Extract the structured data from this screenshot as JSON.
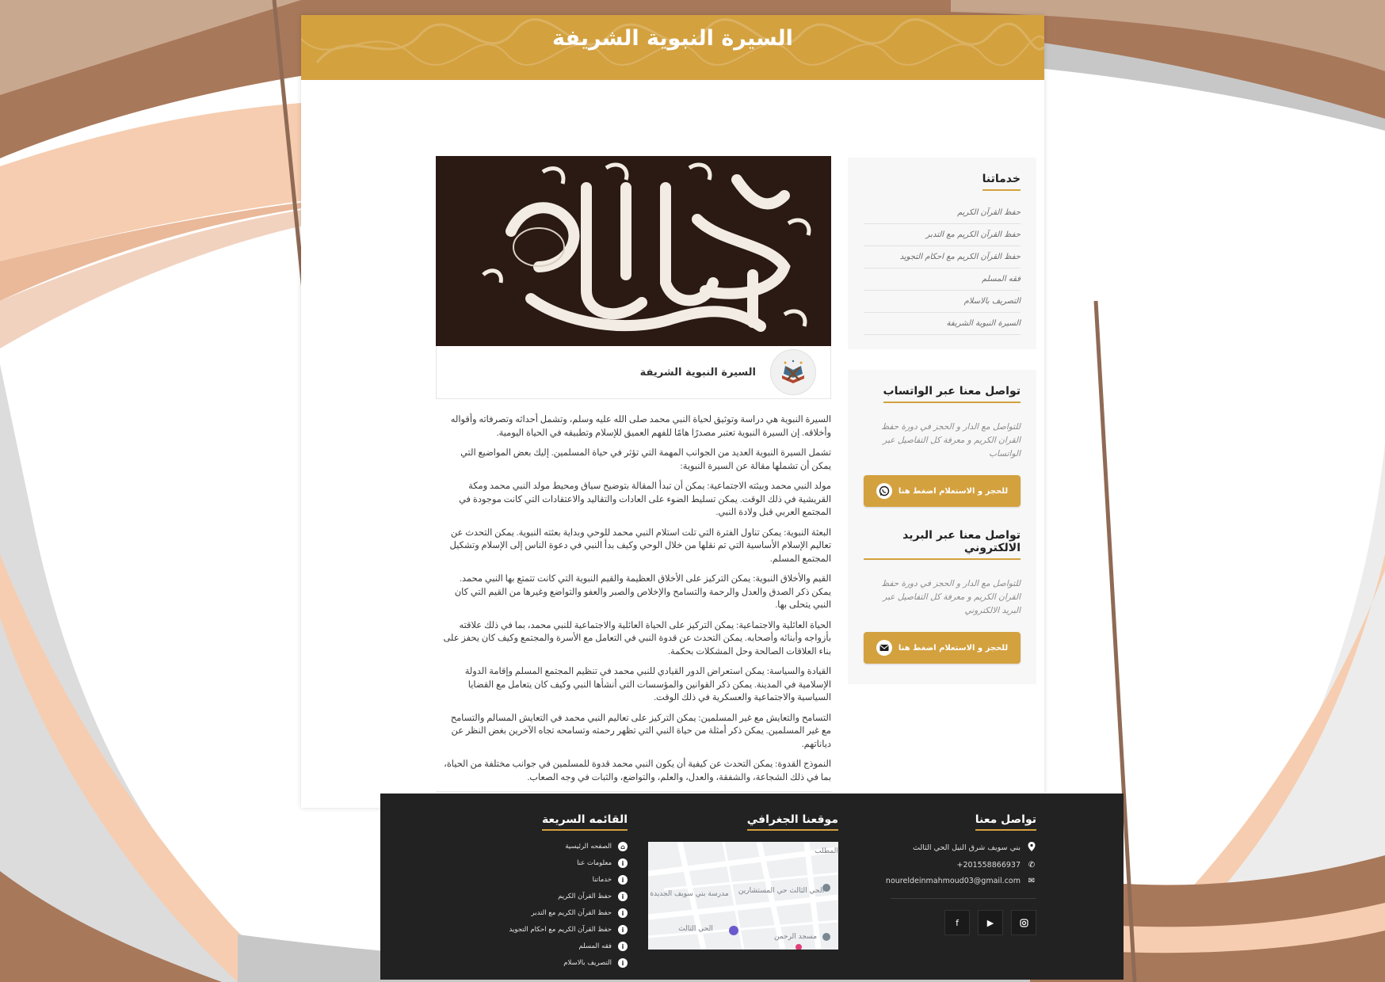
{
  "page": {
    "title": "السيرة النبوية الشريفة"
  },
  "sidebar": {
    "services": {
      "heading": "خدماتنا",
      "items": [
        "حفظ القرآن الكريم",
        "حفظ القرآن الكريم مع التدبر",
        "حفظ القرآن الكريم مع احكام التجويد",
        "فقه المسلم",
        "التصريف بالاسلام",
        "السيرة النبوية الشريفة"
      ]
    },
    "whatsapp": {
      "heading": "تواصل معنا عبر الواتساب",
      "note": "للتواصل مع الدار و الحجز في دورة حفظ القران الكريم و معرفة كل التفاصيل عبر الواتساب",
      "button": "للحجز و الاستعلام اضغط هنا"
    },
    "email": {
      "heading": "تواصل معنا عبر البريد الالكتروني",
      "note": "للتواصل مع الدار و الحجز في دورة حفظ القران الكريم و معرفة كل التفاصيل عبر البريد الالكتروني",
      "button": "للحجز و الاستعلام اضغط هنا"
    }
  },
  "article": {
    "card_title": "السيرة النبوية الشريفة",
    "paragraphs": [
      "السيرة النبوية هي دراسة وتوثيق لحياة النبي محمد صلى الله عليه وسلم، وتشمل أحداثه وتصرفاته وأقواله وأخلاقه. إن السيرة النبوية تعتبر مصدرًا هامًا للفهم العميق للإسلام وتطبيقه في الحياة اليومية.",
      "تشمل السيرة النبوية العديد من الجوانب المهمة التي تؤثر في حياة المسلمين. إليك بعض المواضيع التي يمكن أن تشملها مقالة عن السيرة النبوية:",
      "مولد النبي محمد وبيئته الاجتماعية: يمكن أن تبدأ المقالة بتوضيح سياق ومحيط مولد النبي محمد ومكة القريشية في ذلك الوقت. يمكن تسليط الضوء على العادات والتقاليد والاعتقادات التي كانت موجودة في المجتمع العربي قبل ولادة النبي.",
      "البعثة النبوية: يمكن تناول الفترة التي تلت استلام النبي محمد للوحي وبداية بعثته النبوية. يمكن التحدث عن تعاليم الإسلام الأساسية التي تم نقلها من خلال الوحي وكيف بدأ النبي في دعوة الناس إلى الإسلام وتشكيل المجتمع المسلم.",
      "القيم والأخلاق النبوية: يمكن التركيز على الأخلاق العظيمة والقيم النبوية التي كانت تتمتع بها النبي محمد. يمكن ذكر الصدق والعدل والرحمة والتسامح والإخلاص والصبر والعفو والتواضع وغيرها من القيم التي كان النبي يتحلى بها.",
      "الحياة العائلية والاجتماعية: يمكن التركيز على الحياة العائلية والاجتماعية للنبي محمد، بما في ذلك علاقته بأزواجه وأبنائه وأصحابه. يمكن التحدث عن قدوة النبي في التعامل مع الأسرة والمجتمع وكيف كان يحفز على بناء العلاقات الصالحة وحل المشكلات بحكمة.",
      "القيادة والسياسة: يمكن استعراض الدور القيادي للنبي محمد في تنظيم المجتمع المسلم وإقامة الدولة الإسلامية في المدينة. يمكن ذكر القوانين والمؤسسات التي أنشأها النبي وكيف كان يتعامل مع القضايا السياسية والاجتماعية والعسكرية في ذلك الوقت.",
      "التسامح والتعايش مع غير المسلمين: يمكن التركيز على تعاليم النبي محمد في التعايش المسالم والتسامح مع غير المسلمين. يمكن ذكر أمثلة من حياة النبي التي تظهر رحمته وتسامحه تجاه الآخرين بغض النظر عن دياناتهم.",
      "النموذج القدوة: يمكن التحدث عن كيفية أن يكون النبي محمد قدوة للمسلمين في جوانب مختلفة من الحياة، بما في ذلك الشجاعة، والشفقة، والعدل، والعلم، والتواضع، والثبات في وجه الصعاب."
    ]
  },
  "footer": {
    "contact": {
      "heading": "تواصل معنا",
      "address": "بني سويف شرق النيل الحي الثالث",
      "phone": "+201558866937",
      "email": "noureldeinmahmoud03@gmail.com"
    },
    "location": {
      "heading": "موقعنا الجغرافي"
    },
    "quick_links": {
      "heading": "القائمه السريعة",
      "items": [
        "الصفحه الرئيسية",
        "معلومات عنا",
        "خدماتنا",
        "حفظ القرآن الكريم",
        "حفظ القرآن الكريم مع التدبر",
        "حفظ القرآن الكريم مع احكام التجويد",
        "فقه المسلم",
        "التصريف بالاسلام"
      ]
    }
  },
  "map": {
    "labels": [
      "مدرسة بني سويف الجديدة",
      "الحي الثالث حي المستشارين",
      "الحي الثالث",
      "مسجد الرحمن",
      "المطلب"
    ]
  },
  "colors": {
    "accent": "#d4a13f",
    "footer_bg": "#222222"
  }
}
